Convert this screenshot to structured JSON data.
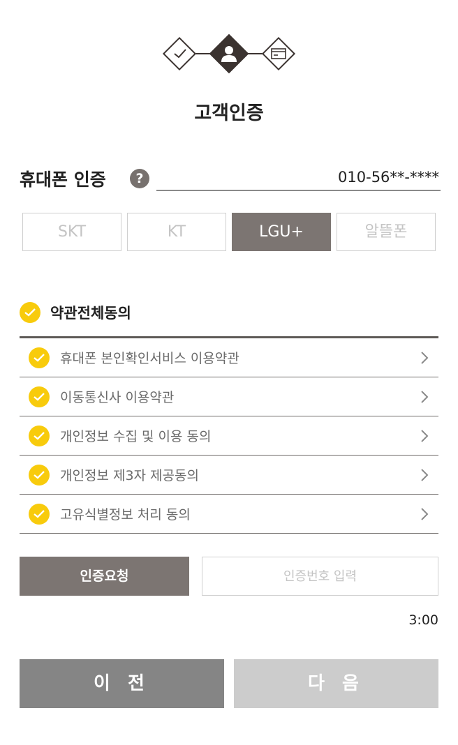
{
  "stepper": {
    "steps": [
      {
        "icon": "check-icon",
        "state": "done"
      },
      {
        "icon": "person-icon",
        "state": "active"
      },
      {
        "icon": "card-icon",
        "state": "pending"
      }
    ]
  },
  "page_title": "고객인증",
  "phone_auth": {
    "label": "휴대폰 인증",
    "help_icon": "?",
    "phone_value": "010-56**-****"
  },
  "carriers": [
    {
      "label": "SKT",
      "selected": false
    },
    {
      "label": "KT",
      "selected": false
    },
    {
      "label": "LGU+",
      "selected": true
    },
    {
      "label": "알뜰폰",
      "selected": false
    }
  ],
  "agree_all": {
    "label": "약관전체동의",
    "checked": true
  },
  "terms": [
    {
      "label": "휴대폰 본인확인서비스 이용약관",
      "checked": true
    },
    {
      "label": "이동통신사 이용약관",
      "checked": true
    },
    {
      "label": "개인정보 수집 및 이용 동의",
      "checked": true
    },
    {
      "label": "개인정보 제3자 제공동의",
      "checked": true
    },
    {
      "label": "고유식별정보 처리 동의",
      "checked": true
    }
  ],
  "verification": {
    "request_label": "인증요청",
    "code_placeholder": "인증번호 입력",
    "code_value": "",
    "timer": "3:00"
  },
  "footer": {
    "prev_label": "이 전",
    "next_label": "다 음"
  },
  "colors": {
    "accent_yellow": "#f8cb0c",
    "selected_gray": "#7c7572",
    "dark_brown": "#3b3330",
    "prev_button": "#858585",
    "next_button_disabled": "#cccccc"
  }
}
